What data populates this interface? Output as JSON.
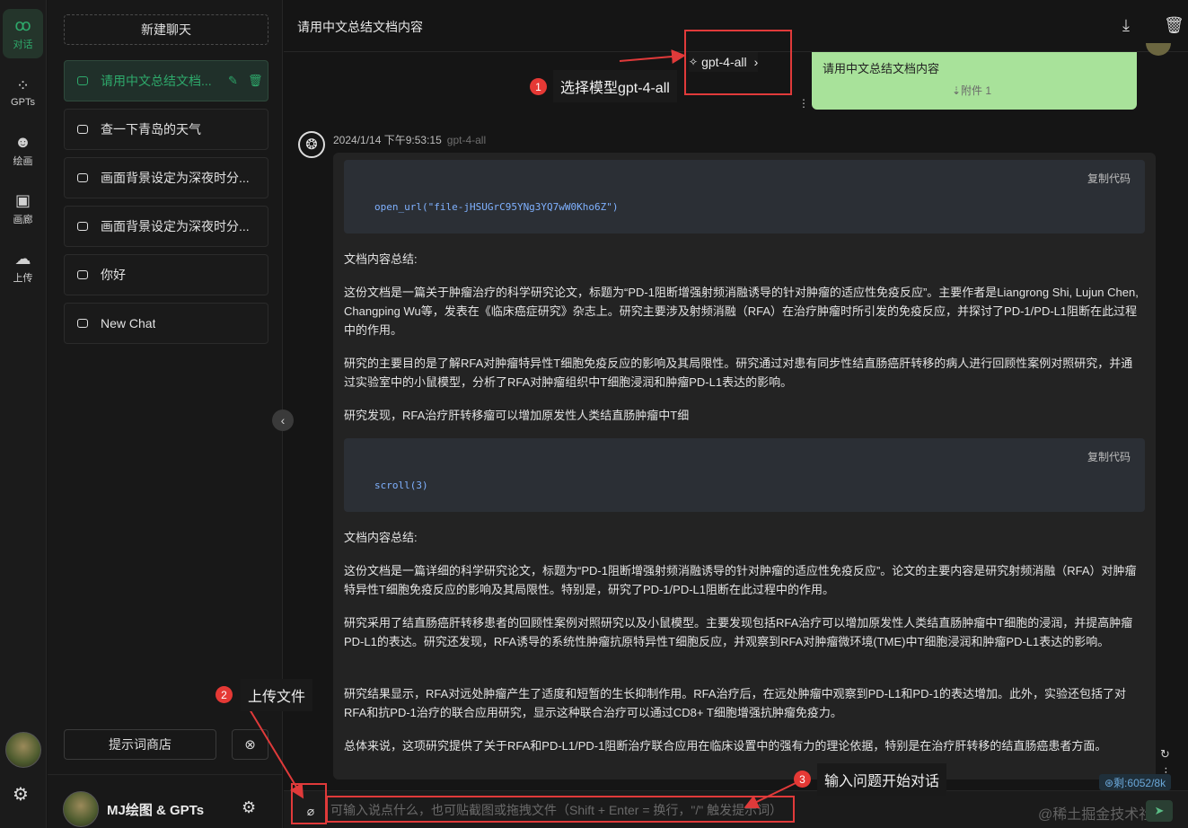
{
  "rail": {
    "items": [
      {
        "label": "对话",
        "icon": "chat-icon",
        "glyph": "ꝏ"
      },
      {
        "label": "GPTs",
        "icon": "grid-icon",
        "glyph": "⁘"
      },
      {
        "label": "绘画",
        "icon": "palette-icon",
        "glyph": "☻"
      },
      {
        "label": "画廊",
        "icon": "image-icon",
        "glyph": "▣"
      },
      {
        "label": "上传",
        "icon": "cloud-upload-icon",
        "glyph": "☁"
      }
    ],
    "settings_glyph": "⚙"
  },
  "sidebar": {
    "new_chat": "新建聊天",
    "chats": [
      {
        "label": "请用中文总结文档..."
      },
      {
        "label": "查一下青岛的天气"
      },
      {
        "label": "画面背景设定为深夜时分..."
      },
      {
        "label": "画面背景设定为深夜时分..."
      },
      {
        "label": "你好"
      },
      {
        "label": "New Chat"
      }
    ],
    "edit_glyph": "✎",
    "delete_glyph": "🗑",
    "prompt_store": "提示词商店",
    "clear_glyph": "⊗",
    "user_name": "MJ绘图 & GPTs",
    "user_settings_glyph": "⚙",
    "collapse_glyph": "‹"
  },
  "header": {
    "title": "请用中文总结文档内容",
    "download_glyph": "⤓",
    "delete_glyph": "🗑"
  },
  "model_selector": {
    "glyph": "✧",
    "label": "gpt-4-all",
    "chevron": "›"
  },
  "user_message": {
    "text": "请用中文总结文档内容",
    "attachment": "⇣附件 1",
    "more_glyph": "⋮"
  },
  "assistant": {
    "logo_glyph": "❂",
    "timestamp": "2024/1/14 下午9:53:15",
    "model": "gpt-4-all",
    "copy_label": "复制代码",
    "code1": "open_url(\"file-jHSUGrC95YNg3YQ7wW0Kho6Z\")",
    "heading1": "文档内容总结:",
    "p1": "这份文档是一篇关于肿瘤治疗的科学研究论文，标题为“PD-1阻断增强射频消融诱导的针对肿瘤的适应性免疫反应”。主要作者是Liangrong Shi, Lujun Chen, Changping Wu等，发表在《临床癌症研究》杂志上。研究主要涉及射频消融（RFA）在治疗肿瘤时所引发的免疫反应，并探讨了PD-1/PD-L1阻断在此过程中的作用。",
    "p2": "研究的主要目的是了解RFA对肿瘤特异性T细胞免疫反应的影响及其局限性。研究通过对患有同步性结直肠癌肝转移的病人进行回顾性案例对照研究，并通过实验室中的小鼠模型，分析了RFA对肿瘤组织中T细胞浸润和肿瘤PD-L1表达的影响。",
    "p3": "研究发现，RFA治疗肝转移瘤可以增加原发性人类结直肠肿瘤中T细",
    "code2": "scroll(3)",
    "heading2": "文档内容总结:",
    "p4": "这份文档是一篇详细的科学研究论文，标题为“PD-1阻断增强射频消融诱导的针对肿瘤的适应性免疫反应”。论文的主要内容是研究射频消融（RFA）对肿瘤特异性T细胞免疫反应的影响及其局限性。特别是，研究了PD-1/PD-L1阻断在此过程中的作用。",
    "p5": "研究采用了结直肠癌肝转移患者的回顾性案例对照研究以及小鼠模型。主要发现包括RFA治疗可以增加原发性人类结直肠肿瘤中T细胞的浸润，并提高肿瘤PD-L1的表达。研究还发现，RFA诱导的系统性肿瘤抗原特异性T细胞反应，并观察到RFA对肿瘤微环境(TME)中T细胞浸润和肿瘤PD-L1表达的影响。",
    "p6": "研究结果显示，RFA对远处肿瘤产生了适度和短暂的生长抑制作用。RFA治疗后，在远处肿瘤中观察到PD-L1和PD-1的表达增加。此外，实验还包括了对RFA和抗PD-1治疗的联合应用研究，显示这种联合治疗可以通过CD8+ T细胞增强抗肿瘤免疫力。",
    "p7": "总体来说，这项研究提供了关于RFA和PD-L1/PD-1阻断治疗联合应用在临床设置中的强有力的理论依据，特别是在治疗肝转移的结直肠癌患者方面。"
  },
  "side_buttons": {
    "refresh_glyph": "↻",
    "more_glyph": "⋮"
  },
  "token_badge": "⊛剩:6052/8k",
  "input": {
    "placeholder": "可输入说点什么，也可贴截图或拖拽文件（Shift + Enter = 换行，\"/\" 触发提示词）",
    "attach_glyph": "⌀",
    "send_glyph": "➤"
  },
  "watermark": "@稀土掘金技术社区",
  "annotations": [
    {
      "num": "1",
      "label": "选择模型gpt-4-all"
    },
    {
      "num": "2",
      "label": "上传文件"
    },
    {
      "num": "3",
      "label": "输入问题开始对话"
    }
  ],
  "colors": {
    "accent": "#2ea96b",
    "user_bubble": "#a8e29a",
    "annotation_red": "#e03a3a"
  }
}
